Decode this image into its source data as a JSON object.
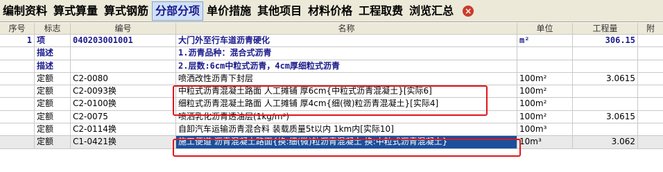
{
  "tabs": [
    {
      "label": "编制资料"
    },
    {
      "label": "算式算量"
    },
    {
      "label": "算式钢筋"
    },
    {
      "label": "分部分项",
      "active": true
    },
    {
      "label": "单价措施"
    },
    {
      "label": "其他项目"
    },
    {
      "label": "材料价格"
    },
    {
      "label": "工程取费"
    },
    {
      "label": "浏览汇总"
    }
  ],
  "close_icon": "×",
  "columns": {
    "seq": "序号",
    "tag": "标志",
    "code": "编号",
    "name": "名称",
    "unit": "单位",
    "qty": "工程量",
    "extra": "附"
  },
  "rows": [
    {
      "type": "project",
      "seq": "1",
      "tag": "项",
      "code": "040203001001",
      "name": "大门外至行车道沥青硬化",
      "unit": "m²",
      "qty": "306.15"
    },
    {
      "type": "desc",
      "seq": "",
      "tag": "描述",
      "code": "",
      "name": "1.沥青品种：混合式沥青",
      "unit": "",
      "qty": ""
    },
    {
      "type": "desc",
      "seq": "",
      "tag": "描述",
      "code": "",
      "name": "2.层数:6cm中粒式沥青，4cm厚细粒式沥青",
      "unit": "",
      "qty": ""
    },
    {
      "type": "quota",
      "seq": "",
      "tag": "定额",
      "code": "C2-0080",
      "name": "喷洒改性沥青下封层",
      "unit": "100m²",
      "qty": "3.0615"
    },
    {
      "type": "quota",
      "seq": "",
      "tag": "定额",
      "code": "C2-0093换",
      "name": "中粒式沥青混凝土路面 人工摊铺 厚6cm{中粒式沥青混凝土}[实际6]",
      "unit": "100m²",
      "qty": ""
    },
    {
      "type": "quota",
      "seq": "",
      "tag": "定额",
      "code": "C2-0100换",
      "name": "细粒式沥青混凝土路面 人工摊铺 厚4cm{细(微)粒沥青混凝土}[实际4]",
      "unit": "100m²",
      "qty": ""
    },
    {
      "type": "quota",
      "seq": "",
      "tag": "定额",
      "code": "C2-0075",
      "name": "喷洒乳化沥青透油层(1kg/m²)",
      "unit": "100m²",
      "qty": "3.0615"
    },
    {
      "type": "quota",
      "seq": "",
      "tag": "定额",
      "code": "C2-0114换",
      "name": "自卸汽车运输沥青混合料 装载质量5t以内 1km内[实际10]",
      "unit": "100m³",
      "qty": ""
    },
    {
      "type": "selected",
      "seq": "",
      "tag": "定额",
      "code": "C1-0421换",
      "name": "施工便道 沥青混凝土路面{换:细(微)粒沥青混凝土 换:中粒式沥青混凝土}",
      "unit": "10m³",
      "qty": "3.062"
    }
  ]
}
